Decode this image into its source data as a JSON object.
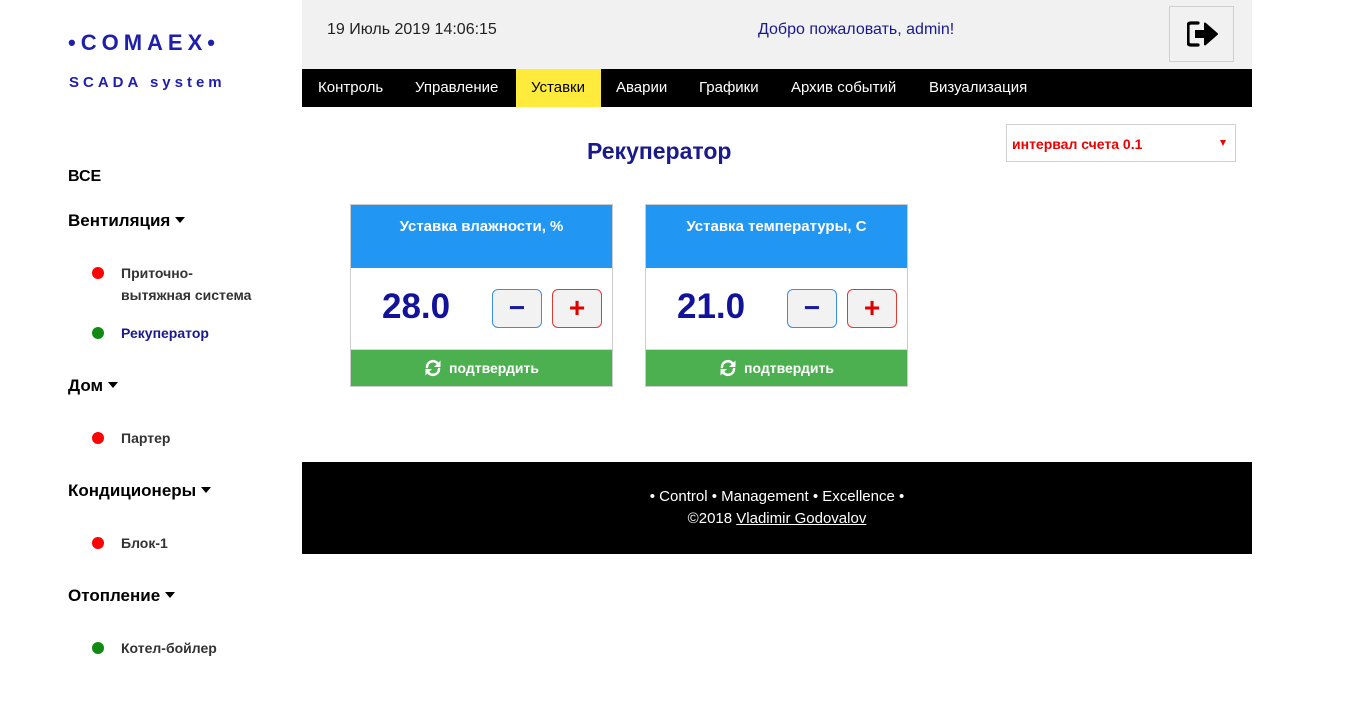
{
  "brand": {
    "logo": "•COMAEX•",
    "subtitle": "SCADA system"
  },
  "header": {
    "datetime": "19 Июль 2019 14:06:15",
    "welcome": "Добро пожаловать, admin!",
    "logout_icon": "sign-out-icon"
  },
  "nav": {
    "tabs": [
      "Контроль",
      "Управление",
      "Уставки",
      "Аварии",
      "Графики",
      "Архив событий",
      "Визуализация"
    ],
    "active": "Уставки"
  },
  "sidebar": {
    "all": "ВСЕ",
    "groups": [
      {
        "label": "Вентиляция",
        "items": [
          {
            "label": "Приточно-вытяжная система",
            "status": "red"
          },
          {
            "label": "Рекуператор",
            "status": "green",
            "active": true
          }
        ]
      },
      {
        "label": "Дом",
        "items": [
          {
            "label": "Партер",
            "status": "red"
          }
        ]
      },
      {
        "label": "Кондиционеры",
        "items": [
          {
            "label": "Блок-1",
            "status": "red"
          }
        ]
      },
      {
        "label": "Отопление",
        "items": [
          {
            "label": "Котел-бойлер",
            "status": "green"
          }
        ]
      }
    ]
  },
  "main": {
    "title": "Рекуператор",
    "interval_select": {
      "value": "интервал счета 0.1"
    },
    "cards": [
      {
        "title": "Уставка влажности, %",
        "value": "28.0",
        "minus": "−",
        "plus": "+",
        "confirm": "подтвердить"
      },
      {
        "title": "Уставка температуры, С",
        "value": "21.0",
        "minus": "−",
        "plus": "+",
        "confirm": "подтвердить"
      }
    ]
  },
  "footer": {
    "tagline": "• Control • Management • Excellence •",
    "copyright": "©2018",
    "author": "Vladimir Godovalov"
  },
  "colors": {
    "brand_blue": "#1a1a8c",
    "nav_bg": "#000000",
    "nav_active": "#ffeb3b",
    "card_head": "#2196f3",
    "confirm_green": "#4caf50",
    "status_red": "#ff0000",
    "status_green": "#108a10",
    "interval_red": "#ee0000"
  }
}
